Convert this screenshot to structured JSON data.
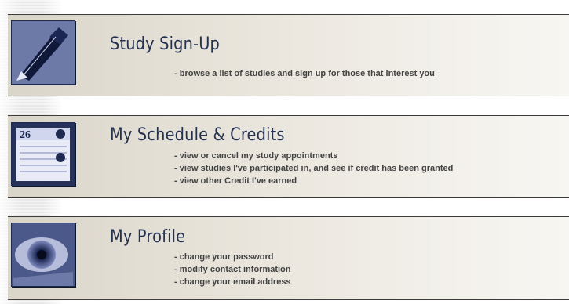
{
  "sections": [
    {
      "title": "Study Sign-Up",
      "icon": "pen-icon",
      "lines": [
        "- browse a list of studies and sign up for those that interest you"
      ]
    },
    {
      "title": "My Schedule & Credits",
      "icon": "calendar-icon",
      "calendar_day": "26",
      "lines": [
        "- view or cancel my study appointments",
        "- view studies I've participated in, and see if credit has been granted",
        "- view other Credit I've earned"
      ]
    },
    {
      "title": "My Profile",
      "icon": "eye-icon",
      "lines": [
        "- change your password",
        "- modify contact information",
        "- change your email address"
      ]
    }
  ],
  "colors": {
    "title": "#24304f",
    "thumb_blue": "#5d6b9a",
    "text": "#424242"
  }
}
